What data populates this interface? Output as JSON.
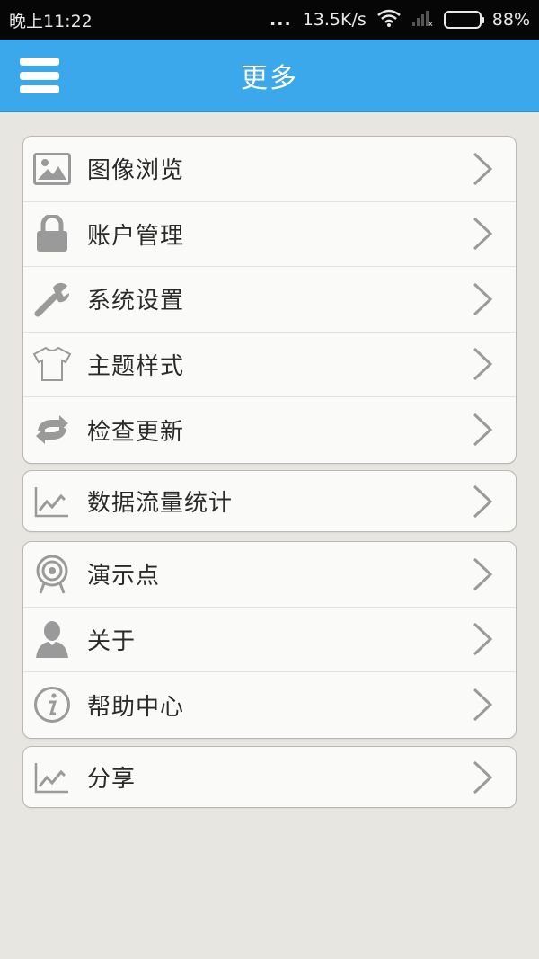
{
  "status_bar": {
    "time": "晚上11:22",
    "dots": "...",
    "speed": "13.5K/s",
    "battery": "88%"
  },
  "header": {
    "title": "更多"
  },
  "groups": [
    {
      "items": [
        {
          "label": "图像浏览",
          "icon": "image-icon"
        },
        {
          "label": "账户管理",
          "icon": "lock-icon"
        },
        {
          "label": "系统设置",
          "icon": "wrench-icon"
        },
        {
          "label": "主题样式",
          "icon": "tshirt-icon"
        },
        {
          "label": "检查更新",
          "icon": "refresh-icon"
        }
      ]
    },
    {
      "items": [
        {
          "label": "数据流量统计",
          "icon": "chart-icon"
        }
      ]
    },
    {
      "items": [
        {
          "label": "演示点",
          "icon": "target-icon"
        },
        {
          "label": "关于",
          "icon": "person-icon"
        },
        {
          "label": "帮助中心",
          "icon": "info-icon"
        }
      ]
    },
    {
      "items": [
        {
          "label": "分享",
          "icon": "chart-icon"
        }
      ]
    }
  ],
  "colors": {
    "header": "#3aa8ea",
    "background": "#e7e6e0",
    "icon": "#9a9a9a"
  }
}
